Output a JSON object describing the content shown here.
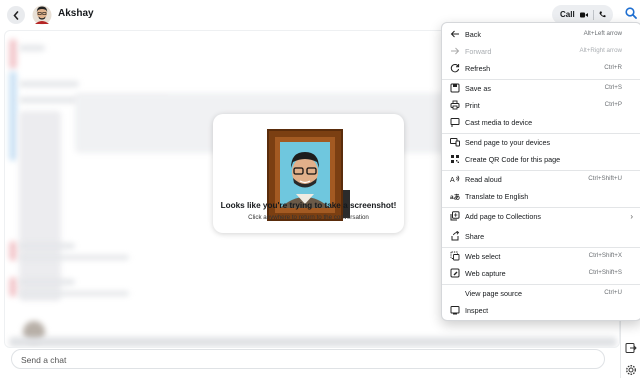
{
  "header": {
    "contact_name": "Akshay",
    "call_label": "Call",
    "icons": [
      "back-arrow-icon",
      "video-call-icon",
      "phone-icon",
      "search-icon"
    ]
  },
  "screenshot_notice": {
    "title": "Looks like you're trying to take a screenshot!",
    "subtitle": "Click anywhere to return to the conversation"
  },
  "composer": {
    "placeholder": "Send a chat"
  },
  "context_menu": {
    "items": [
      {
        "label": "Back",
        "shortcut": "Alt+Left arrow",
        "icon": "back-arrow-icon",
        "enabled": true
      },
      {
        "label": "Forward",
        "shortcut": "Alt+Right arrow",
        "icon": "forward-arrow-icon",
        "enabled": false
      },
      {
        "label": "Refresh",
        "shortcut": "Ctrl+R",
        "icon": "refresh-icon",
        "enabled": true
      },
      {
        "label": "Save as",
        "shortcut": "Ctrl+S",
        "icon": "save-as-icon",
        "enabled": true
      },
      {
        "label": "Print",
        "shortcut": "Ctrl+P",
        "icon": "print-icon",
        "enabled": true
      },
      {
        "label": "Cast media to device",
        "shortcut": "",
        "icon": "cast-icon",
        "enabled": true
      },
      {
        "label": "Send page to your devices",
        "shortcut": "",
        "icon": "send-to-devices-icon",
        "enabled": true
      },
      {
        "label": "Create QR Code for this page",
        "shortcut": "",
        "icon": "qr-code-icon",
        "enabled": true
      },
      {
        "label": "Read aloud",
        "shortcut": "Ctrl+Shift+U",
        "icon": "read-aloud-icon",
        "enabled": true
      },
      {
        "label": "Translate to English",
        "shortcut": "",
        "icon": "translate-icon",
        "enabled": true
      },
      {
        "label": "Add page to Collections",
        "shortcut": "",
        "icon": "collections-icon",
        "enabled": true
      },
      {
        "label": "Share",
        "shortcut": "",
        "icon": "share-icon",
        "enabled": true
      },
      {
        "label": "Web select",
        "shortcut": "Ctrl+Shift+X",
        "icon": "web-select-icon",
        "enabled": true
      },
      {
        "label": "Web capture",
        "shortcut": "Ctrl+Shift+S",
        "icon": "web-capture-icon",
        "enabled": true
      },
      {
        "label": "View page source",
        "shortcut": "Ctrl+U",
        "icon": "",
        "enabled": true
      },
      {
        "label": "Inspect",
        "shortcut": "",
        "icon": "inspect-icon",
        "enabled": true
      }
    ]
  },
  "colors": {
    "accent": "#0fadff",
    "menu_text": "#1b1b1b",
    "frame_wood": "#8a4b1c"
  }
}
